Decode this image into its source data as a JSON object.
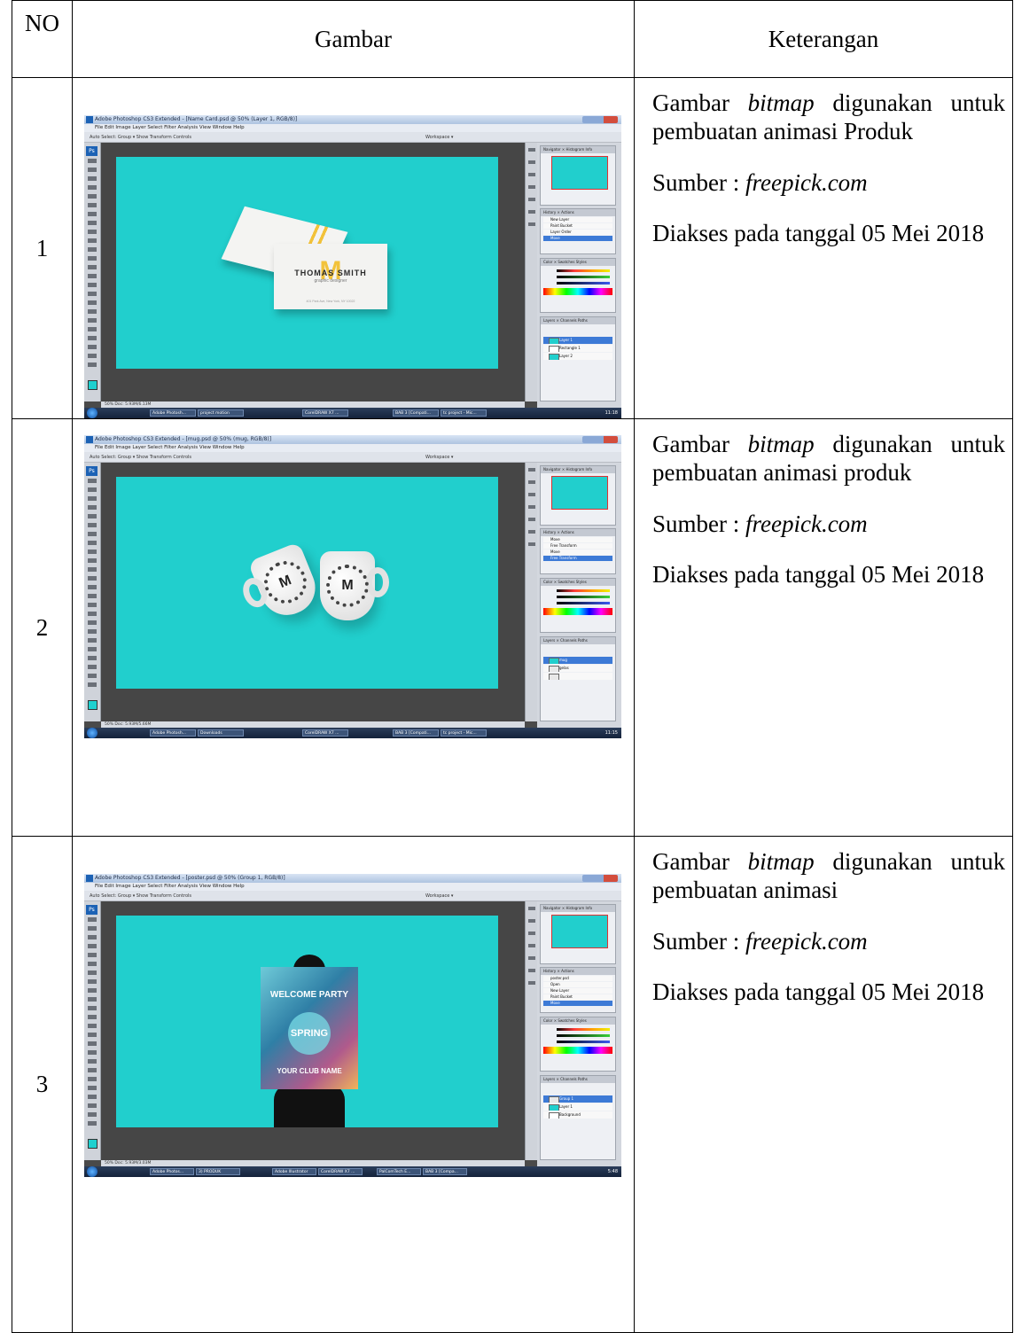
{
  "table": {
    "headers": {
      "no": "NO",
      "gambar": "Gambar",
      "keterangan": "Keterangan"
    },
    "rows": [
      {
        "no": "1",
        "ket": {
          "l1_a": "Gambar",
          "l1_em": "bitmap",
          "l1_b": "digunakan",
          "l2": "untuk pembuatan animasi",
          "l3": "Produk",
          "sumber_label": "Sumber : ",
          "sumber_site": "freepick.com",
          "akses": "Diakses pada tanggal 05 Mei 2018"
        },
        "screenshot": {
          "title": "Adobe Photoshop CS3 Extended - [Name Card.psd @ 50% (Layer 1, RGB/8)]",
          "history": [
            "New Layer",
            "Paint Bucket",
            "Layer Order",
            "Move"
          ],
          "layers": [
            "Layer 1",
            "Rectangle 1",
            "Layer 2"
          ],
          "taskbar": [
            "Adobe Photosh...",
            "project motion",
            "CorelDRAW X7 ...",
            "BAB 3 [Compati...",
            "tc project - Mic..."
          ],
          "clock": "11:18",
          "status": "50%    Doc: 5.93M/6.13M",
          "card_name": "THOMAS SMITH",
          "card_role": "graphic designer",
          "card_letter": "M",
          "card_addr": "401 Park Ave, New York, NY 10022"
        }
      },
      {
        "no": "2",
        "ket": {
          "l1_a": "Gambar",
          "l1_em": "bitmap",
          "l1_b": "digunakan",
          "l2": "untuk pembuatan animasi",
          "l3": "produk",
          "sumber_label": "Sumber : ",
          "sumber_site": "freepick.com",
          "akses": "Diakses pada tanggal 05 Mei 2018"
        },
        "screenshot": {
          "title": "Adobe Photoshop CS3 Extended - [mug.psd @ 50% (mug, RGB/8)]",
          "history": [
            "Move",
            "Free Transform",
            "Move",
            "Free Transform"
          ],
          "layers": [
            "mug",
            "gelas",
            ""
          ],
          "taskbar": [
            "Adobe Photosh...",
            "Downloads",
            "CorelDRAW X7 ...",
            "BAB 3 [Compati...",
            "tc project - Mic..."
          ],
          "clock": "11:15",
          "status": "50%    Doc: 5.93M/5.66M",
          "mug_letter": "M"
        }
      },
      {
        "no": "3",
        "ket": {
          "l1_a": "Gambar",
          "l1_em": "bitmap",
          "l1_b": "digunakan",
          "l2": "untuk pembuatan animasi",
          "l3": "",
          "sumber_label": "Sumber : ",
          "sumber_site": "freepick.com",
          "akses": "Diakses pada tanggal 05 Mei 2018"
        },
        "screenshot": {
          "title": "Adobe Photoshop CS3 Extended - [poster.psd @ 50% (Group 1, RGB/8)]",
          "history": [
            "poster.psd",
            "Open",
            "New Layer",
            "Paint Bucket",
            "Move"
          ],
          "layers": [
            "Group 1",
            "Layer 1",
            "Background"
          ],
          "taskbar": [
            "Adobe Photos...",
            "3) PRODUK",
            "Adobe Illustrator",
            "CorelDRAW X7 ...",
            "PalComTech E...",
            "BAB 3 [Compa..."
          ],
          "clock": "5:48",
          "status": "50%    Doc: 5.93M/3.03M",
          "poster_t1": "WELCOME PARTY",
          "poster_t2": "SPRING",
          "poster_t3": "YOUR CLUB NAME"
        }
      }
    ]
  },
  "ps_common": {
    "menu": "File   Edit   Image   Layer   Select   Filter   Analysis   View   Window   Help",
    "options": "Auto Select: Group  ▾   Show Transform Controls",
    "workspace": "Workspace ▾",
    "tabs_nav": "Navigator × Histogram  Info",
    "tabs_hist": "History ×  Actions",
    "tabs_color": "Color × Swatches  Styles",
    "tabs_layers": "Layers × Channels  Paths",
    "logo": "Ps"
  },
  "colors": {
    "canvas": "#21cfcd",
    "workspace_bg": "#464646"
  }
}
